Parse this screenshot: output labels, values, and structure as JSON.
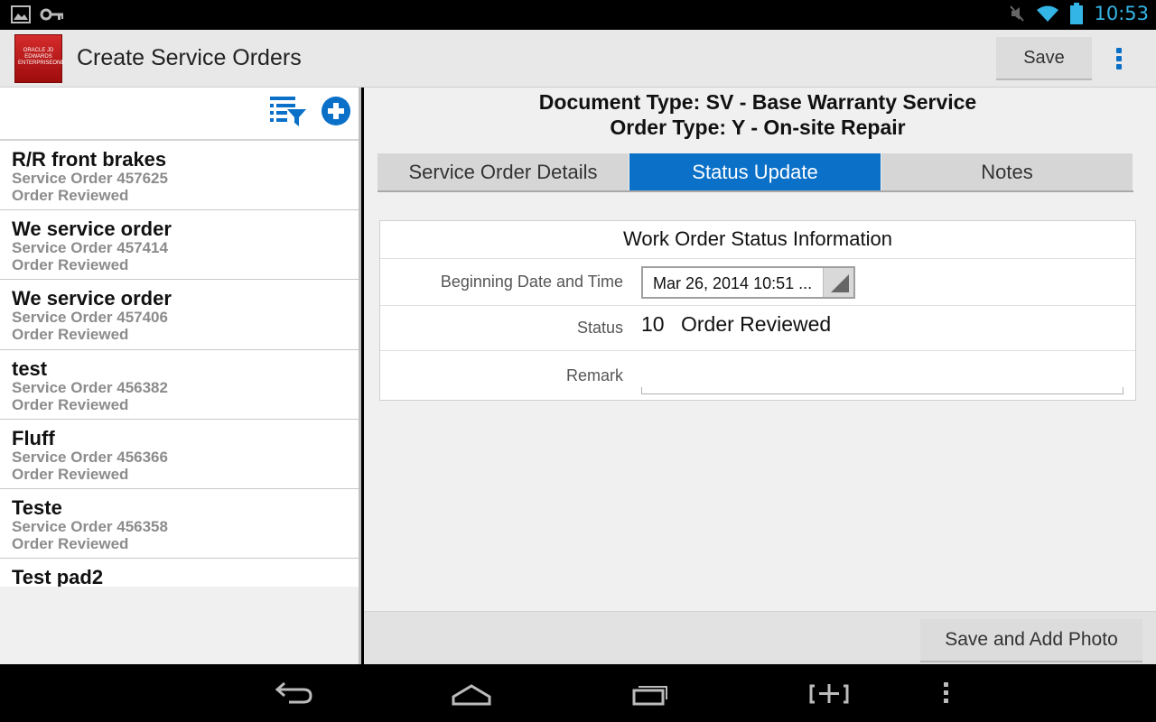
{
  "status_bar": {
    "time": "10:53",
    "icons": [
      "image-icon",
      "key-icon",
      "mute-icon",
      "wifi-icon",
      "battery-icon"
    ]
  },
  "action_bar": {
    "logo_text": "ORACLE JD EDWARDS ENTERPRISEONE",
    "title": "Create Service Orders",
    "save_label": "Save"
  },
  "left_pane": {
    "orders": [
      {
        "title": "R/R front brakes",
        "order": "Service Order 457625",
        "status": "Order Reviewed"
      },
      {
        "title": "We service order",
        "order": "Service Order 457414",
        "status": "Order Reviewed"
      },
      {
        "title": "We service order",
        "order": "Service Order 457406",
        "status": "Order Reviewed"
      },
      {
        "title": "test",
        "order": "Service Order 456382",
        "status": "Order Reviewed"
      },
      {
        "title": "Fluff",
        "order": "Service Order 456366",
        "status": "Order Reviewed"
      },
      {
        "title": "Teste",
        "order": "Service Order 456358",
        "status": "Order Reviewed"
      },
      {
        "title": "Test pad2",
        "order": "",
        "status": ""
      }
    ]
  },
  "detail": {
    "document_type": "Document Type: SV - Base Warranty Service",
    "order_type": "Order Type: Y - On-site Repair",
    "tabs": [
      {
        "label": "Service Order Details"
      },
      {
        "label": "Status Update"
      },
      {
        "label": "Notes"
      }
    ],
    "section_title": "Work Order Status Information",
    "begin_label": "Beginning Date and Time",
    "begin_value": "Mar 26, 2014 10:51 ...",
    "status_label": "Status",
    "status_code": "10",
    "status_text": "Order Reviewed",
    "remark_label": "Remark",
    "remark_value": ""
  },
  "bottom": {
    "save_photo_label": "Save and Add Photo"
  },
  "colors": {
    "accent": "#0a70c8",
    "status_bar_icons": "#33b5e5"
  }
}
